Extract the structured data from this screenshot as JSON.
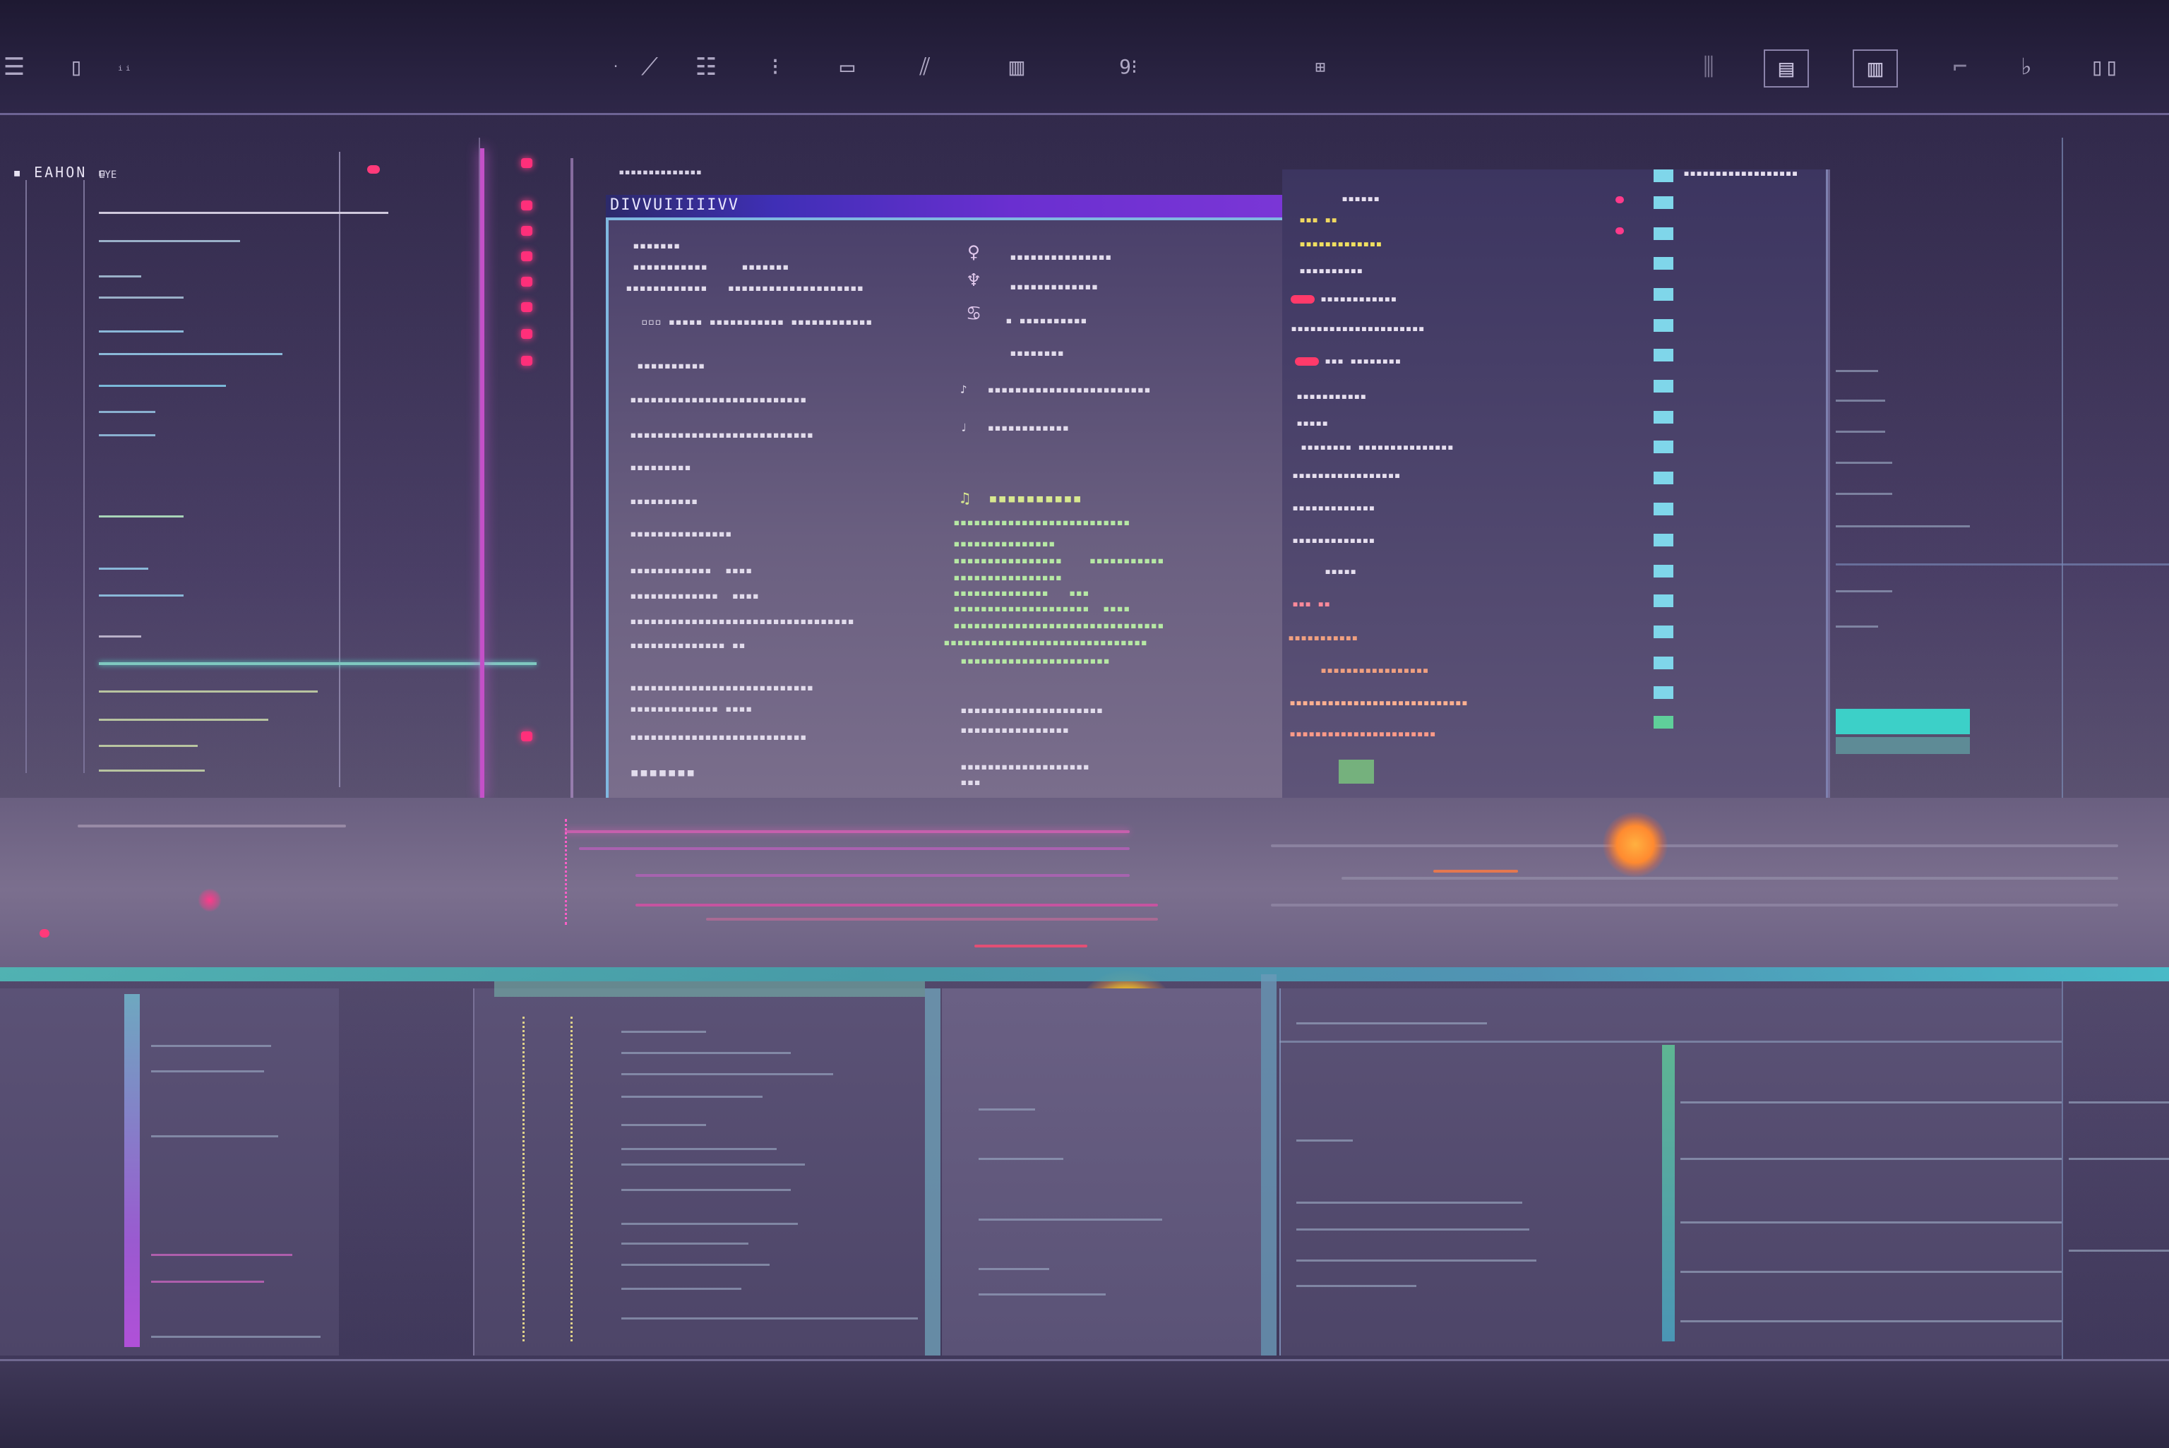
{
  "toolbar": {
    "icons": [
      {
        "name": "menu-icon",
        "glyph": "☰"
      },
      {
        "name": "panel-icon",
        "glyph": "▯"
      },
      {
        "name": "text-icon",
        "glyph": "ᵢᵢ"
      },
      {
        "name": "brush-icon",
        "glyph": "⟋"
      },
      {
        "name": "list-icon",
        "glyph": "☷"
      },
      {
        "name": "pin-icon",
        "glyph": "⁝"
      },
      {
        "name": "frame-icon",
        "glyph": "▭"
      },
      {
        "name": "tool-icon",
        "glyph": "⫽"
      },
      {
        "name": "grid-icon",
        "glyph": "▥"
      },
      {
        "name": "number-icon",
        "glyph": "9⁝"
      },
      {
        "name": "graph-icon",
        "glyph": "⊞"
      },
      {
        "name": "split-icon",
        "glyph": "⫼"
      },
      {
        "name": "layers-icon",
        "glyph": "▤"
      },
      {
        "name": "bars-icon",
        "glyph": "▥"
      },
      {
        "name": "flag-icon",
        "glyph": "⌐"
      },
      {
        "name": "drop-icon",
        "glyph": "♭"
      },
      {
        "name": "window-icon",
        "glyph": "▯▯"
      }
    ]
  },
  "left_panel": {
    "title": "▪ EAHON ▫",
    "subtitle": "EYE"
  },
  "dialog": {
    "header_label": "DIVVUIIIIIVV"
  },
  "colors": {
    "accent_magenta": "#d05ad8",
    "accent_cyan": "#3cd0c8",
    "accent_red": "#ff3a6a",
    "orb_yellow": "#ffd02a",
    "orb_orange": "#ff9a2a"
  }
}
